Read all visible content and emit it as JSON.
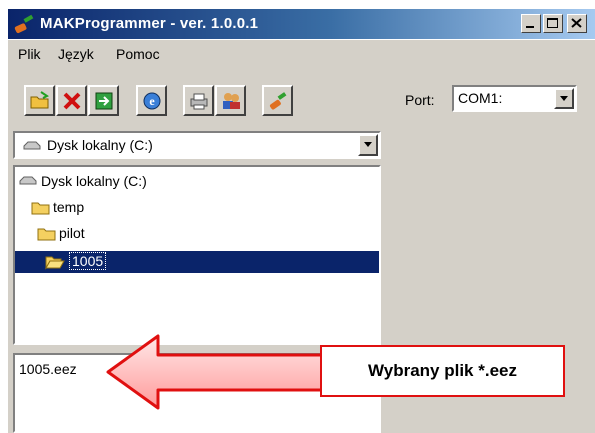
{
  "window": {
    "title": "MAKProgrammer - ver. 1.0.0.1"
  },
  "menu": {
    "items": [
      "Plik",
      "Język",
      "Pomoc"
    ]
  },
  "toolbar": {
    "buttons": [
      "open-folder-icon",
      "close-x-icon",
      "exit-door-icon",
      "ie-globe-icon",
      "print-icon",
      "users-icon",
      "write-icon"
    ],
    "port_label": "Port:",
    "port_value": "COM1:"
  },
  "drive": {
    "selected": "Dysk lokalny (C:)"
  },
  "tree": {
    "items": [
      {
        "label": "Dysk lokalny (C:)",
        "icon": "drive-icon"
      },
      {
        "label": "temp",
        "icon": "folder-icon"
      },
      {
        "label": "pilot",
        "icon": "folder-icon"
      },
      {
        "label": "1005",
        "icon": "folder-open-icon",
        "selected": true
      }
    ]
  },
  "files": {
    "items": [
      "1005.eez"
    ]
  },
  "annotation": {
    "text": "Wybrany plik *.eez"
  },
  "colors": {
    "titlebar": "#0a246a",
    "selection": "#0a246a",
    "annotation": "#e01010"
  }
}
